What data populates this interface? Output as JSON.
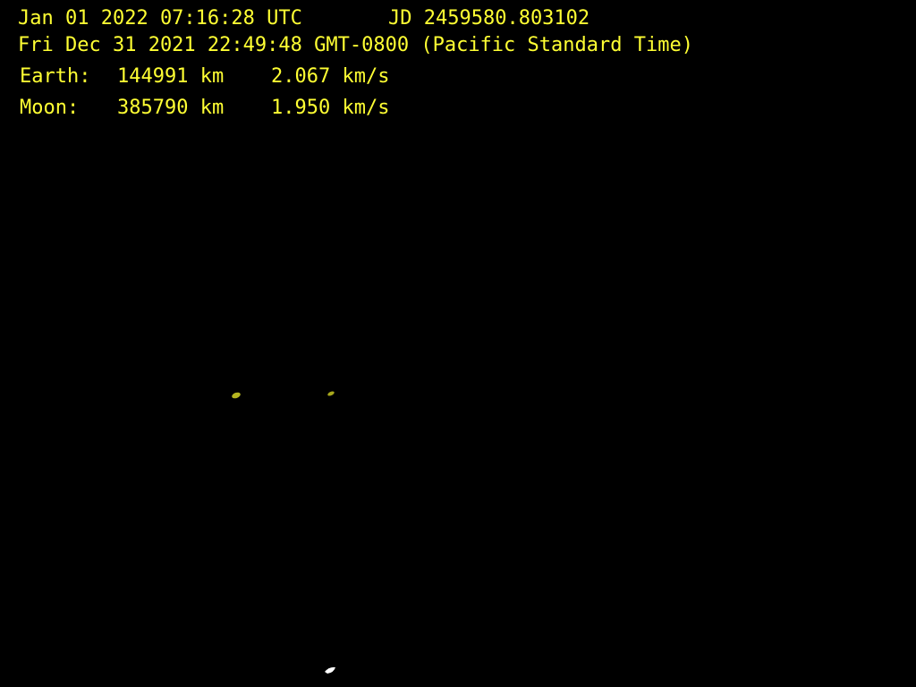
{
  "readout": {
    "utc": "Jan 01 2022 07:16:28 UTC",
    "jd": "JD 2459580.803102",
    "local": "Fri Dec 31 2021 22:49:48 GMT-0800 (Pacific Standard Time)",
    "earth": {
      "label": "Earth:",
      "distance": "144991 km",
      "speed": "2.067 km/s"
    },
    "moon": {
      "label": "Moon:",
      "distance": "385790 km",
      "speed": "1.950 km/s"
    }
  },
  "colors": {
    "background": "#000000",
    "text": "#ffff33",
    "earth_marker": "#b5b520",
    "moon_marker": "#a8a81c",
    "spacecraft_marker": "#ffffff"
  },
  "icons": {
    "earth": "earth-icon",
    "moon": "moon-icon",
    "spacecraft": "spacecraft-icon"
  }
}
